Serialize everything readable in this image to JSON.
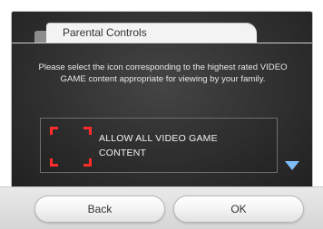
{
  "title": "Parental Controls",
  "instruction": "Please select the icon corresponding to the highest rated VIDEO GAME content appropriate for viewing by your family.",
  "option": {
    "label_line1": "ALLOW ALL VIDEO GAME",
    "label_line2": "CONTENT"
  },
  "buttons": {
    "back": "Back",
    "ok": "OK"
  },
  "colors": {
    "selection_corners": "#ff2a2a",
    "scroll_arrow": "#7fbef6"
  },
  "icons": {
    "scroll": "triangle-down-icon"
  }
}
